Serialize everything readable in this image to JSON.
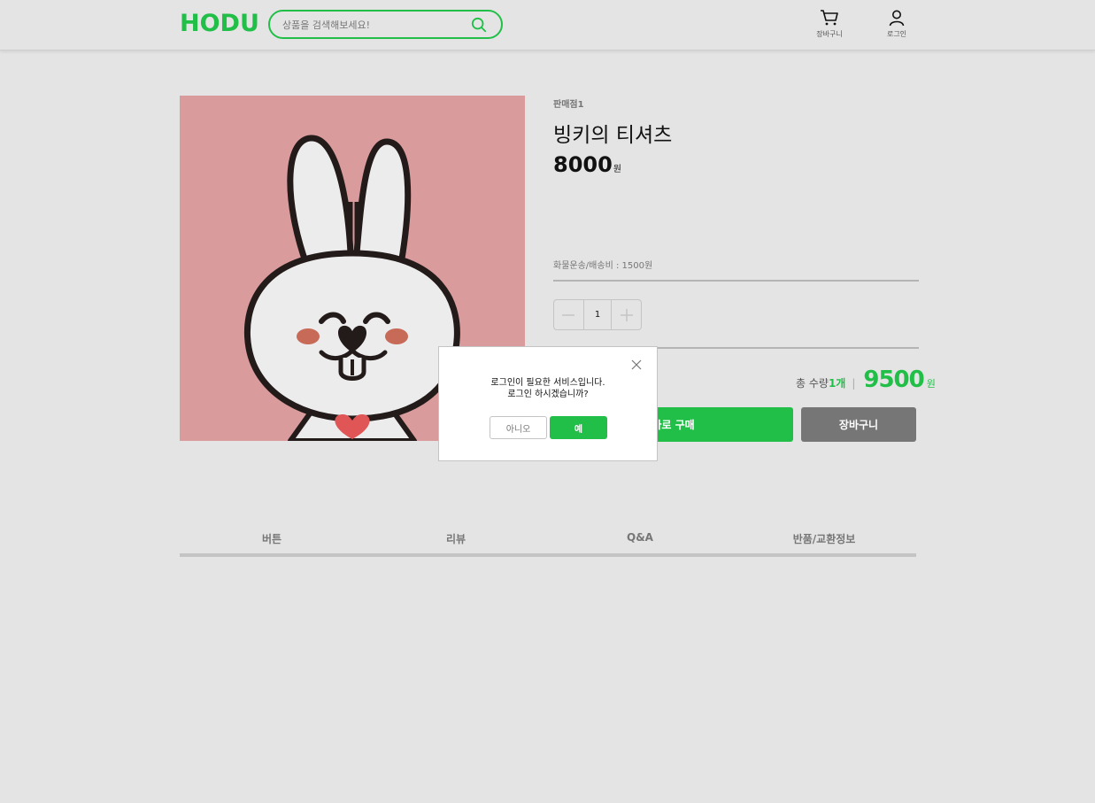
{
  "header": {
    "logo": "HODU",
    "search_placeholder": "상품을 검색해보세요!",
    "cart_label": "장바구니",
    "login_label": "로그인"
  },
  "product": {
    "seller": "판매점1",
    "name": "빙키의 티셔츠",
    "price": "8000",
    "price_unit": "원",
    "shipping": "화물운송/배송비 : 1500원",
    "quantity": "1",
    "total_label": "총 수량",
    "total_count": "1개",
    "total_separator": "|",
    "total_amount": "9500",
    "total_unit": "원",
    "buy_label": "바로 구매",
    "cart_label": "장바구니"
  },
  "tabs": [
    "버튼",
    "리뷰",
    "Q&A",
    "반품/교환정보"
  ],
  "modal": {
    "line1": "로그인이 필요한 서비스입니다.",
    "line2": "로그인 하시겠습니까?",
    "no_label": "아니오",
    "yes_label": "예"
  },
  "colors": {
    "accent": "#21bf48",
    "background": "#e4e4e4",
    "product_image_bg": "#d99b9b",
    "cart_button": "#767676"
  }
}
